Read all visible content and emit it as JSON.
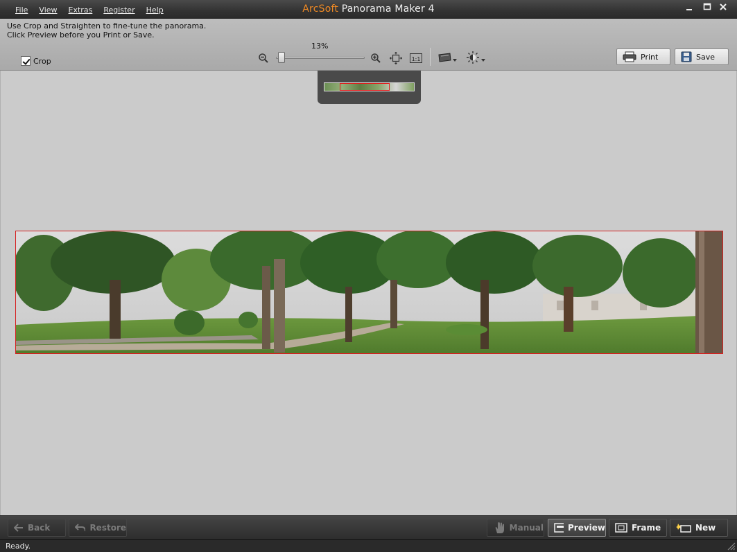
{
  "window": {
    "brand": "ArcSoft",
    "product": "Panorama Maker 4",
    "controls": [
      "minimize",
      "maximize",
      "close"
    ]
  },
  "menu": {
    "items": [
      "File",
      "View",
      "Extras",
      "Register",
      "Help"
    ]
  },
  "toolbar": {
    "hint_line1": "Use Crop and Straighten to fine-tune the panorama.",
    "hint_line2": "Click Preview before you Print or Save.",
    "crop_label": "Crop",
    "crop_checked": true,
    "zoom_percent": "13%",
    "zoom_level": 0.13,
    "print_label": "Print",
    "save_label": "Save",
    "icons": [
      "zoom-out-icon",
      "zoom-in-icon",
      "fit-to-window-icon",
      "actual-size-icon",
      "straighten-icon",
      "brightness-icon"
    ]
  },
  "canvas": {
    "background": "#cbcbcb",
    "crop_frame_color": "#d62020",
    "image_description_colors": [
      "#4f7a38",
      "#7fa45a",
      "#d9d9d9"
    ]
  },
  "bottom": {
    "back_label": "Back",
    "restore_label": "Restore",
    "manual_label": "Manual",
    "preview_label": "Preview",
    "frame_label": "Frame",
    "new_label": "New"
  },
  "status": {
    "text": "Ready."
  }
}
